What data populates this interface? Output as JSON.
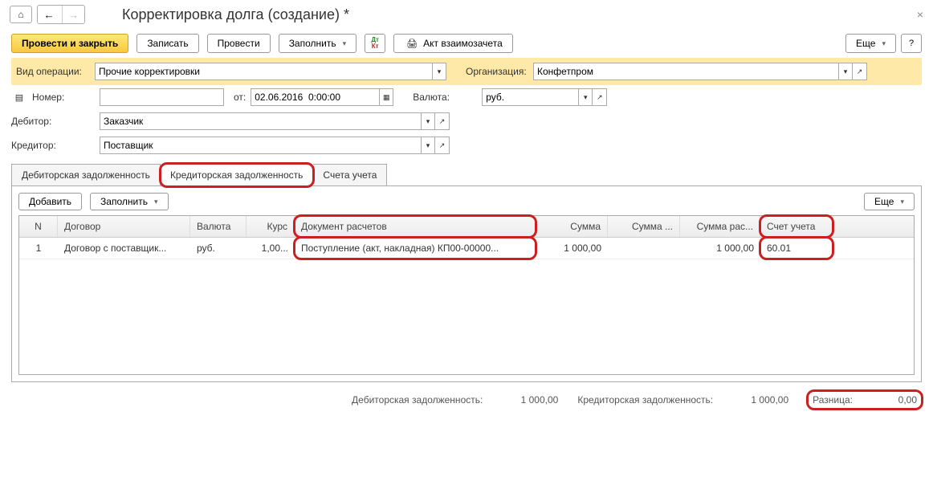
{
  "title": "Корректировка долга (создание) *",
  "toolbar": {
    "post_close": "Провести и закрыть",
    "save": "Записать",
    "post": "Провести",
    "fill": "Заполнить",
    "netting_act": "Акт взаимозачета",
    "more": "Еще"
  },
  "form": {
    "op_type_label": "Вид операции:",
    "op_type_value": "Прочие корректировки",
    "org_label": "Организация:",
    "org_value": "Конфетпром",
    "number_label": "Номер:",
    "date_label": "от:",
    "date_value": "02.06.2016  0:00:00",
    "currency_label": "Валюта:",
    "currency_value": "руб.",
    "debtor_label": "Дебитор:",
    "debtor_value": "Заказчик",
    "creditor_label": "Кредитор:",
    "creditor_value": "Поставщик"
  },
  "tabs": {
    "debit": "Дебиторская задолженность",
    "credit": "Кредиторская задолженность",
    "accounts": "Счета учета"
  },
  "tab_toolbar": {
    "add": "Добавить",
    "fill": "Заполнить",
    "more": "Еще"
  },
  "grid": {
    "headers": {
      "n": "N",
      "contract": "Договор",
      "currency": "Валюта",
      "rate": "Курс",
      "doc": "Документ расчетов",
      "sum": "Сумма",
      "sum2": "Сумма ...",
      "sum3": "Сумма рас...",
      "acct": "Счет учета"
    },
    "rows": [
      {
        "n": "1",
        "contract": "Договор с поставщик...",
        "currency": "руб.",
        "rate": "1,00...",
        "doc": "Поступление (акт, накладная) КП00-00000...",
        "sum": "1 000,00",
        "sum2": "",
        "sum3": "1 000,00",
        "acct": "60.01"
      }
    ]
  },
  "footer": {
    "debit_label": "Дебиторская задолженность:",
    "debit_value": "1 000,00",
    "credit_label": "Кредиторская задолженность:",
    "credit_value": "1 000,00",
    "diff_label": "Разница:",
    "diff_value": "0,00"
  }
}
